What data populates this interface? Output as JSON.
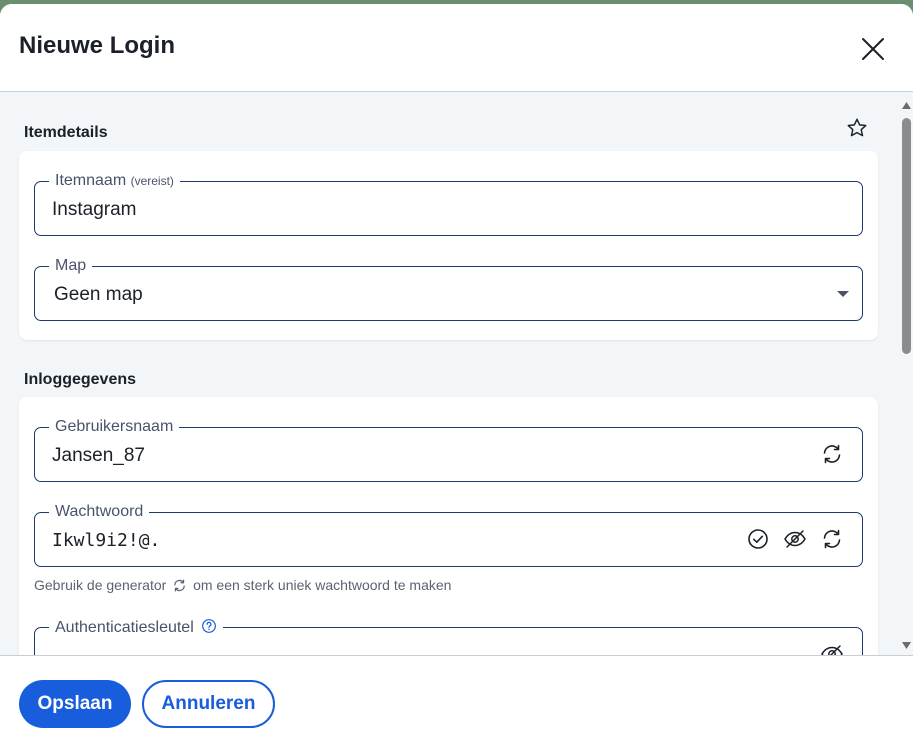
{
  "dialog": {
    "title": "Nieuwe Login"
  },
  "item_details": {
    "heading": "Itemdetails",
    "item_name": {
      "label": "Itemnaam",
      "required_hint": "(vereist)",
      "value": "Instagram"
    },
    "folder": {
      "label": "Map",
      "value": "Geen map"
    }
  },
  "login_credentials": {
    "heading": "Inloggegevens",
    "username": {
      "label": "Gebruikersnaam",
      "value": "Jansen_87"
    },
    "password": {
      "label": "Wachtwoord",
      "value": "Ikwl9i2!@.",
      "hint_before": "Gebruik de generator",
      "hint_after": "om een sterk uniek wachtwoord te maken"
    },
    "auth_key": {
      "label": "Authenticatiesleutel"
    }
  },
  "footer": {
    "save_label": "Opslaan",
    "cancel_label": "Annuleren"
  },
  "colors": {
    "accent": "#175ddc",
    "border": "#1d3a6e",
    "background": "#f3f6f9"
  }
}
